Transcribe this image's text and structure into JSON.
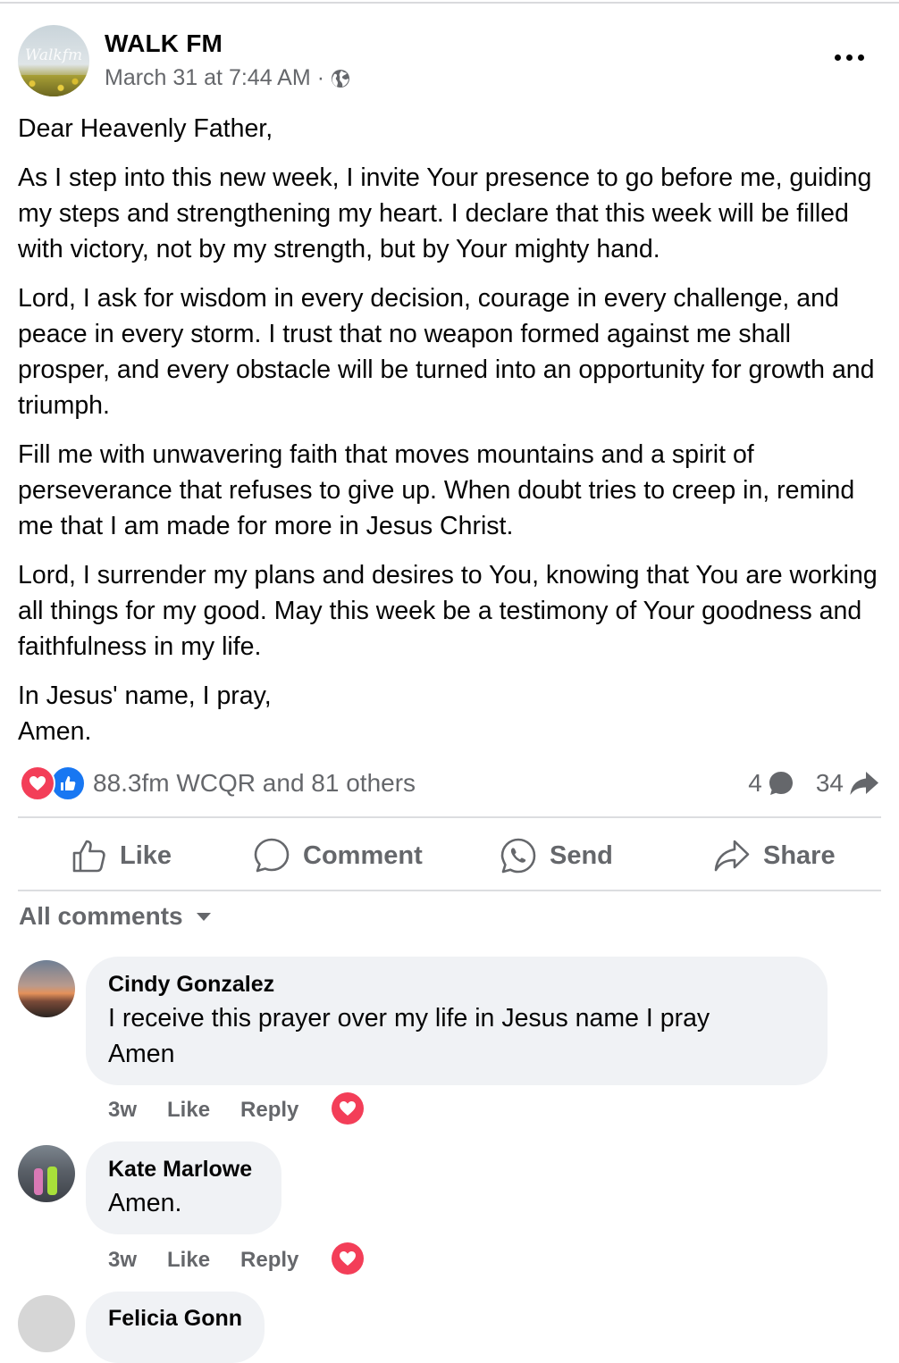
{
  "post": {
    "page_name": "WALK FM",
    "avatar_logo_text": "Walkfm",
    "timestamp": "March 31 at 7:44 AM",
    "separator": "·",
    "audience_icon": "globe-icon",
    "more_icon": "more-options-icon",
    "paragraphs": [
      "Dear Heavenly Father,",
      "As I step into this new week, I invite Your presence to go before me, guiding my steps and strengthening my heart. I declare that this week will be filled with victory, not by my strength, but by Your mighty hand.",
      "Lord, I ask for wisdom in every decision, courage in every challenge, and peace in every storm. I trust that no weapon formed against me shall prosper, and every obstacle will be turned into an opportunity for growth and triumph.",
      "Fill me with unwavering faith that moves mountains and a spirit of perseverance that refuses to give up. When doubt tries to creep in, remind me that I am made for more in Jesus Christ.",
      "Lord, I surrender my plans and desires to You, knowing that You are working all things for my good. May this week be a testimony of Your goodness and faithfulness in my life."
    ],
    "closing": [
      "In Jesus' name, I pray,",
      "Amen."
    ]
  },
  "reactions": {
    "icons": [
      "love-reaction-icon",
      "like-reaction-icon"
    ],
    "text": "88.3fm WCQR and 81 others",
    "comment_count": "4",
    "share_count": "34",
    "colors": {
      "love": "#f33e58",
      "like": "#1877f2",
      "muted": "#65676b"
    }
  },
  "actions": {
    "like": "Like",
    "comment": "Comment",
    "send": "Send",
    "share": "Share"
  },
  "comments_filter": {
    "label": "All comments",
    "icon": "caret-down-icon"
  },
  "comments": [
    {
      "author": "Cindy Gonzalez",
      "lines": [
        "I receive this prayer over my life in Jesus name I pray",
        "Amen"
      ],
      "time": "3w",
      "like": "Like",
      "reply": "Reply",
      "reaction": "love-reaction-icon"
    },
    {
      "author": "Kate Marlowe",
      "lines": [
        "Amen."
      ],
      "time": "3w",
      "like": "Like",
      "reply": "Reply",
      "reaction": "love-reaction-icon"
    },
    {
      "author": "Felicia Gonn"
    }
  ]
}
